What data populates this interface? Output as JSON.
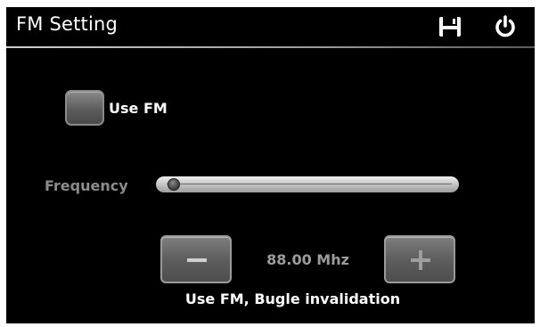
{
  "window": {
    "title": "FM Setting"
  },
  "toolbar": {
    "save_icon": "save-icon",
    "power_icon": "power-icon"
  },
  "fm": {
    "use_fm_label": "Use FM",
    "use_fm_checked": false
  },
  "frequency": {
    "label": "Frequency",
    "value_text": "88.00 Mhz",
    "slider_fraction": 0.0,
    "decrease_icon": "minus-icon",
    "increase_icon": "plus-icon"
  },
  "status": {
    "message": "Use FM, Bugle invalidation"
  },
  "colors": {
    "background": "#000000",
    "title_text": "#ffffff",
    "disabled_text": "#8c8c8c",
    "button_face": "#5e5e5e"
  }
}
